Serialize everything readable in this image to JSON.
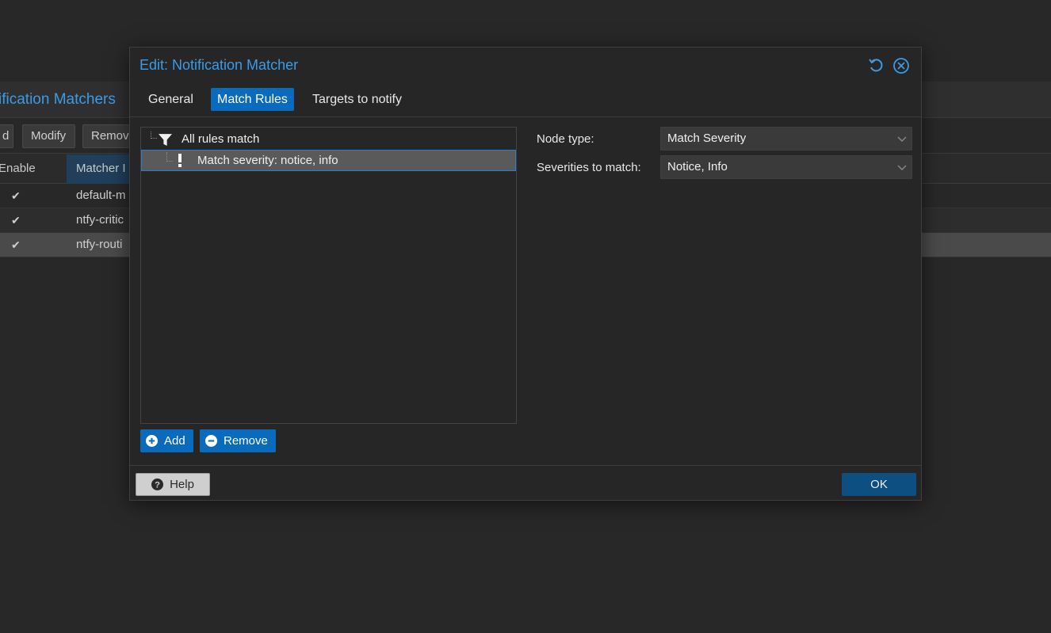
{
  "background": {
    "panel_title": "Notification Matchers",
    "panel_title_visible": "ification Matchers",
    "toolbar": {
      "add_label_visible": "d",
      "modify_label": "Modify",
      "remove_label_visible": "Remov"
    },
    "grid": {
      "columns": {
        "enable_visible": "Enable",
        "matcher_visible": "Matcher I"
      },
      "rows": [
        {
          "enabled": "✔",
          "name_visible": "default-m"
        },
        {
          "enabled": "✔",
          "name_visible": "ntfy-critic"
        },
        {
          "enabled": "✔",
          "name_visible": "ntfy-routi"
        }
      ]
    }
  },
  "dialog": {
    "title": "Edit: Notification Matcher",
    "tools": [
      "reset-icon",
      "close-icon"
    ],
    "tabs": [
      {
        "label": "General",
        "active": false
      },
      {
        "label": "Match Rules",
        "active": true
      },
      {
        "label": "Targets to notify",
        "active": false
      }
    ],
    "tree": {
      "root": {
        "icon": "filter-icon",
        "label": "All rules match"
      },
      "child": {
        "icon": "exclamation-icon",
        "label": "Match severity: notice, info",
        "selected": true
      }
    },
    "tree_buttons": {
      "add_label": "Add",
      "remove_label": "Remove"
    },
    "form": {
      "node_type_label": "Node type:",
      "node_type_value": "Match Severity",
      "severities_label": "Severities to match:",
      "severities_value": "Notice, Info"
    },
    "footer": {
      "help_label": "Help",
      "ok_label": "OK"
    }
  },
  "colors": {
    "accent": "#3b9be6",
    "primary_button": "#0a6bbd",
    "background": "#282828"
  }
}
